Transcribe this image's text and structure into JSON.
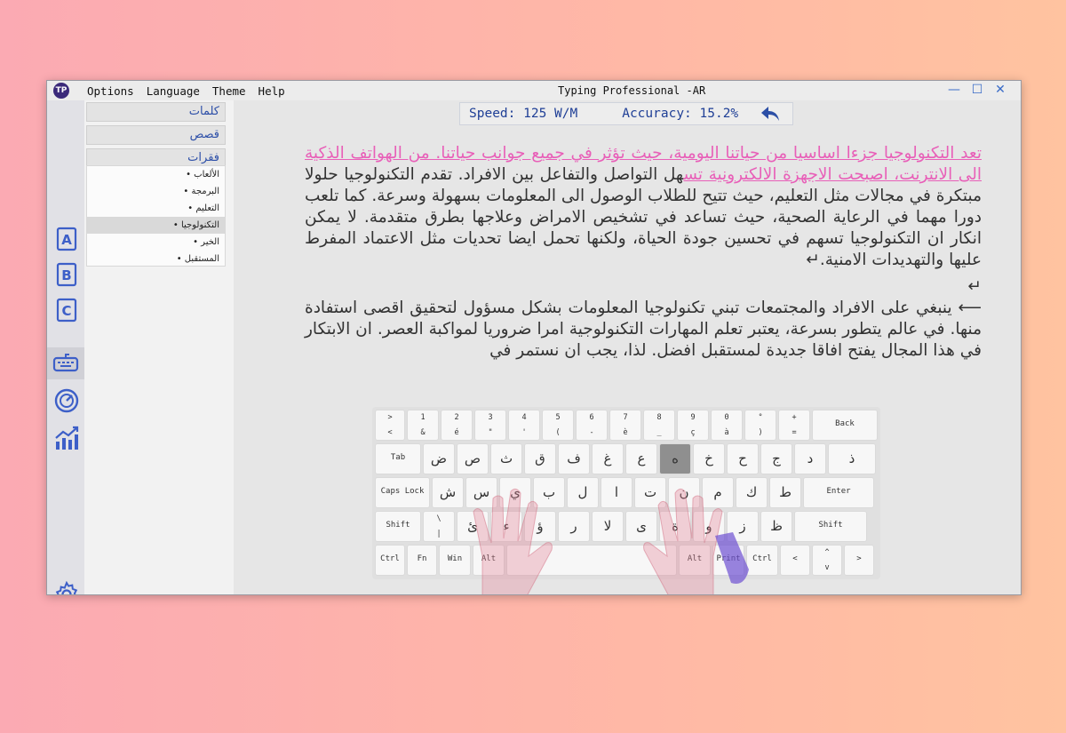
{
  "window": {
    "title": "Typing Professional -AR",
    "logo": "TP"
  },
  "menu": [
    "Options",
    "Language",
    "Theme",
    "Help"
  ],
  "window_controls": {
    "minimize": "—",
    "maximize": "☐",
    "close": "✕"
  },
  "sidebar": {
    "categories": [
      "كلمات",
      "قصص",
      "فقرات"
    ],
    "items": [
      "• الألعاب",
      "• البرمجة",
      "• التعليم",
      "• التكنولوجيا",
      "• الخير",
      "• المستقبل"
    ],
    "selected_item": 3
  },
  "icons": [
    "lesson-a-icon",
    "lesson-b-icon",
    "lesson-c-icon",
    "keyboard-icon",
    "speedometer-icon",
    "chart-icon",
    "settings-icon"
  ],
  "stats": {
    "speed": "Speed: 125 W/M",
    "accuracy": "Accuracy: 15.2%",
    "back_icon": "undo-icon"
  },
  "text": {
    "typed": "تعد التكنولوجيا جزءا اساسيا من حياتنا اليومية، حيث تؤثر في جميع جوانب حياتنا. من الهواتف الذكية الى الانترنت، اصبحت الاجهزة الالكترونية تس",
    "remaining": "هل التواصل والتفاعل بين الافراد. تقدم التكنولوجيا حلولا مبتكرة في مجالات مثل التعليم، حيث تتيح للطلاب الوصول الى المعلومات بسهولة وسرعة. كما تلعب دورا مهما في الرعاية الصحية، حيث تساعد في تشخيص الامراض وعلاجها بطرق متقدمة. لا يمكن انكار ان التكنولوجيا تسهم في تحسين جودة الحياة، ولكنها تحمل ايضا تحديات مثل الاعتماد المفرط عليها والتهديدات الامنية.↵",
    "pilcrow": "↵",
    "paragraph2": "⟵ ينبغي على الافراد والمجتمعات تبني تكنولوجيا المعلومات بشكل مسؤول لتحقيق اقصى استفادة منها. في عالم يتطور بسرعة، يعتبر تعلم المهارات التكنولوجية امرا ضروريا لمواكبة العصر. ان الابتكار في هذا المجال يفتح افاقا جديدة لمستقبل افضل. لذا، يجب ان نستمر في"
  },
  "keyboard": {
    "highlight_color": "#8f8f8f",
    "rows": [
      [
        {
          "top": ">",
          "bottom": "<",
          "w": 34
        },
        {
          "top": "1",
          "bottom": "&",
          "w": 36
        },
        {
          "top": "2",
          "bottom": "é",
          "w": 36
        },
        {
          "top": "3",
          "bottom": "\"",
          "w": 36
        },
        {
          "top": "4",
          "bottom": "'",
          "w": 36
        },
        {
          "top": "5",
          "bottom": "(",
          "w": 36
        },
        {
          "top": "6",
          "bottom": "-",
          "w": 36
        },
        {
          "top": "7",
          "bottom": "è",
          "w": 36
        },
        {
          "top": "8",
          "bottom": "_",
          "w": 36
        },
        {
          "top": "9",
          "bottom": "ç",
          "w": 36
        },
        {
          "top": "0",
          "bottom": "à",
          "w": 36
        },
        {
          "top": "°",
          "bottom": ")",
          "w": 36
        },
        {
          "top": "+",
          "bottom": "=",
          "w": 36
        },
        {
          "label": "Back",
          "w": 74
        }
      ],
      [
        {
          "label": "Tab",
          "w": 52
        },
        {
          "ar": "ض",
          "w": 36
        },
        {
          "ar": "ص",
          "w": 36
        },
        {
          "ar": "ث",
          "w": 36
        },
        {
          "ar": "ق",
          "w": 36
        },
        {
          "ar": "ف",
          "w": 36
        },
        {
          "ar": "غ",
          "w": 36
        },
        {
          "ar": "ع",
          "w": 36
        },
        {
          "ar": "ه",
          "w": 36,
          "highlight": true
        },
        {
          "ar": "خ",
          "w": 36
        },
        {
          "ar": "ح",
          "w": 36
        },
        {
          "ar": "ج",
          "w": 36
        },
        {
          "ar": "د",
          "w": 36
        },
        {
          "ar": "ذ",
          "w": 54
        }
      ],
      [
        {
          "label": "Caps Lock",
          "w": 62
        },
        {
          "ar": "ش",
          "w": 36
        },
        {
          "ar": "س",
          "w": 36
        },
        {
          "ar": "ي",
          "w": 36
        },
        {
          "ar": "ب",
          "w": 36
        },
        {
          "ar": "ل",
          "w": 36
        },
        {
          "ar": "ا",
          "w": 36
        },
        {
          "ar": "ت",
          "w": 36
        },
        {
          "ar": "ن",
          "w": 36
        },
        {
          "ar": "م",
          "w": 36
        },
        {
          "ar": "ك",
          "w": 36
        },
        {
          "ar": "ط",
          "w": 36
        },
        {
          "label": "Enter",
          "w": 80
        }
      ],
      [
        {
          "label": "Shift",
          "w": 52
        },
        {
          "top": "\\",
          "bottom": "|",
          "w": 36
        },
        {
          "ar": "ئ",
          "w": 36
        },
        {
          "ar": "ء",
          "w": 36
        },
        {
          "ar": "ؤ",
          "w": 36
        },
        {
          "ar": "ر",
          "w": 36
        },
        {
          "ar": "لا",
          "w": 36
        },
        {
          "ar": "ى",
          "w": 36
        },
        {
          "ar": "ة",
          "w": 36
        },
        {
          "ar": "و",
          "w": 36
        },
        {
          "ar": "ز",
          "w": 36
        },
        {
          "ar": "ظ",
          "w": 36
        },
        {
          "label": "Shift",
          "w": 82
        }
      ],
      [
        {
          "label": "Ctrl",
          "w": 34
        },
        {
          "label": "Fn",
          "w": 34
        },
        {
          "label": "Win",
          "w": 36
        },
        {
          "label": "Alt",
          "w": 36
        },
        {
          "label": "",
          "w": 192
        },
        {
          "label": "Alt",
          "w": 36
        },
        {
          "label": "Print",
          "w": 36
        },
        {
          "label": "Ctrl",
          "w": 36
        },
        {
          "label": "<",
          "w": 34
        },
        {
          "top": "^",
          "bottom": "v",
          "w": 34
        },
        {
          "label": ">",
          "w": 34
        }
      ]
    ]
  }
}
